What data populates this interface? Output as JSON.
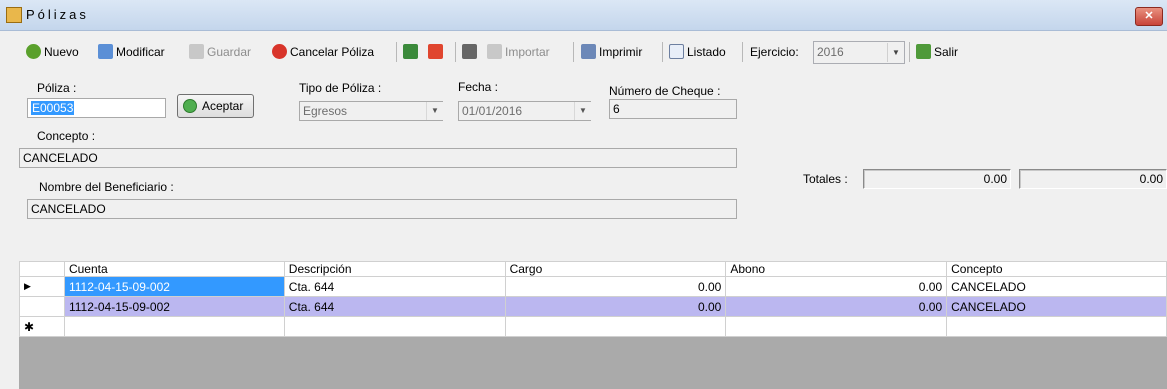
{
  "window": {
    "title": "Pólizas",
    "close_label": "✕"
  },
  "toolbar": {
    "nuevo": "Nuevo",
    "modificar": "Modificar",
    "guardar": "Guardar",
    "cancelar_poliza": "Cancelar Póliza",
    "importar": "Importar",
    "imprimir": "Imprimir",
    "listado": "Listado",
    "ejercicio_label": "Ejercicio:",
    "ejercicio_value": "2016",
    "salir": "Salir"
  },
  "form": {
    "poliza_label": "Póliza :",
    "poliza_value": "E00053",
    "aceptar_label": "Aceptar",
    "tipo_label": "Tipo de Póliza :",
    "tipo_value": "Egresos",
    "fecha_label": "Fecha :",
    "fecha_value": "01/01/2016",
    "cheque_label": "Número de Cheque :",
    "cheque_value": "6",
    "concepto_label": "Concepto :",
    "concepto_value": "CANCELADO",
    "beneficiario_label": "Nombre del Beneficiario :",
    "beneficiario_value": "CANCELADO",
    "totales_label": "Totales :",
    "total_cargo": "0.00",
    "total_abono": "0.00"
  },
  "grid": {
    "headers": [
      "Cuenta",
      "Descripción",
      "Cargo",
      "Abono",
      "Concepto"
    ],
    "rows": [
      {
        "marker": "▶",
        "cuenta": "1112-04-15-09-002",
        "descripcion": "Cta. 644",
        "cargo": "0.00",
        "abono": "0.00",
        "concepto": "CANCELADO"
      },
      {
        "marker": "",
        "cuenta": "1112-04-15-09-002",
        "descripcion": "Cta. 644",
        "cargo": "0.00",
        "abono": "0.00",
        "concepto": "CANCELADO"
      }
    ],
    "new_row_marker": "✱"
  },
  "colors": {
    "selected": "#3399ff",
    "alt_row": "#bbb7f0",
    "grid_bg": "#aaaaaa"
  }
}
